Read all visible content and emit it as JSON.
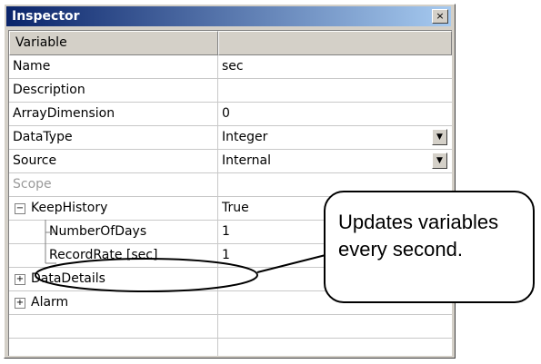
{
  "window": {
    "title": "Inspector",
    "close_glyph": "×"
  },
  "header": {
    "col1": "Variable",
    "col2": ""
  },
  "rows": [
    {
      "label": "Name",
      "value": "sec"
    },
    {
      "label": "Description",
      "value": ""
    },
    {
      "label": "ArrayDimension",
      "value": "0"
    },
    {
      "label": "DataType",
      "value": "Integer",
      "dropdown": true
    },
    {
      "label": "Source",
      "value": "Internal",
      "dropdown": true
    },
    {
      "label": "Scope",
      "value": "",
      "disabled": true
    },
    {
      "label": "KeepHistory",
      "value": "True",
      "expander": "−"
    },
    {
      "label": "NumberOfDays",
      "value": "1"
    },
    {
      "label": "RecordRate [sec]",
      "value": "1"
    },
    {
      "label": "DataDetails",
      "value": "",
      "expander": "+"
    },
    {
      "label": "Alarm",
      "value": "",
      "expander": "+"
    }
  ],
  "callout": {
    "line1": "Updates variables",
    "line2": "every second."
  },
  "icons": {
    "close": "close-icon",
    "dropdown": "dropdown-arrow-icon",
    "collapse": "collapse-icon",
    "expand": "expand-icon"
  },
  "colors": {
    "titlebar_start": "#0a246a",
    "titlebar_end": "#a6caf0",
    "chrome": "#d4d0c8"
  }
}
